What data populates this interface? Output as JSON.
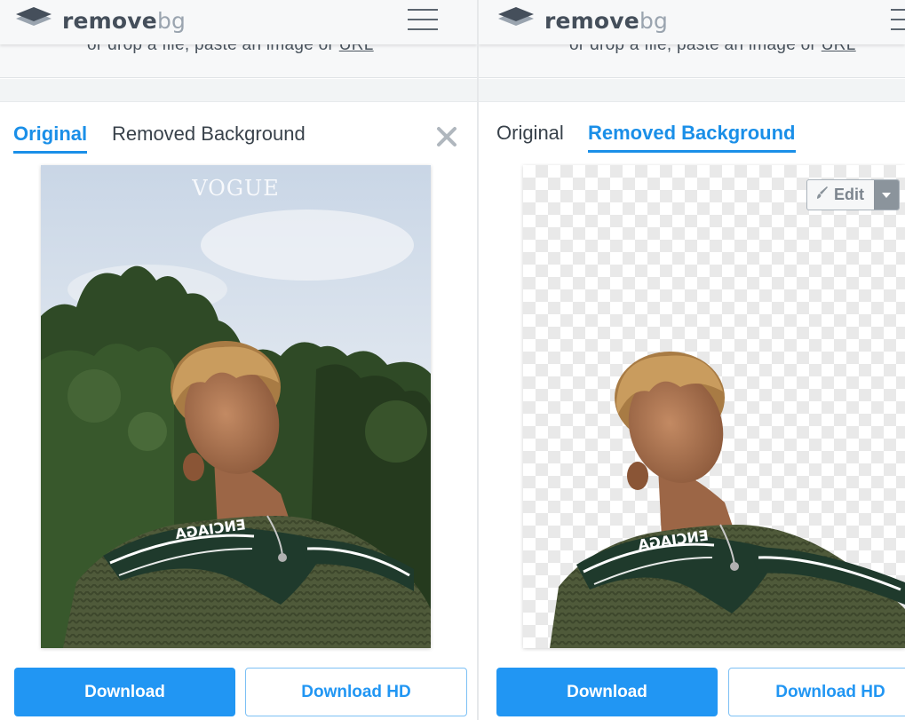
{
  "left": {
    "brand": {
      "name": "remove",
      "suffix": "bg"
    },
    "drop_hint": {
      "text": "or drop a file, paste an image or ",
      "link": "URL"
    },
    "tabs": [
      {
        "label": "Original",
        "active": true
      },
      {
        "label": "Removed Background",
        "active": false
      }
    ],
    "image": {
      "magazine_title": "VOGUE",
      "shirt_text": "ENCIAGA"
    },
    "buttons": {
      "download": "Download",
      "download_hd": "Download HD"
    }
  },
  "right": {
    "brand": {
      "name": "remove",
      "suffix": "bg"
    },
    "drop_hint": {
      "text": "or drop a file, paste an image or ",
      "link": "URL"
    },
    "tabs": [
      {
        "label": "Original",
        "active": false
      },
      {
        "label": "Removed Background",
        "active": true
      }
    ],
    "edit": {
      "label": "Edit"
    },
    "image": {
      "shirt_text": "ENCIAGA"
    },
    "buttons": {
      "download": "Download",
      "download_hd": "Download HD"
    }
  },
  "colors": {
    "accent": "#2196f3",
    "tab_active": "#1a8fe8",
    "brand_text": "#454f5b",
    "brand_suffix": "#9aa4af"
  },
  "icons": [
    "logo-layers-icon",
    "hamburger-menu-icon",
    "close-icon",
    "brush-icon",
    "chevron-down-icon"
  ]
}
